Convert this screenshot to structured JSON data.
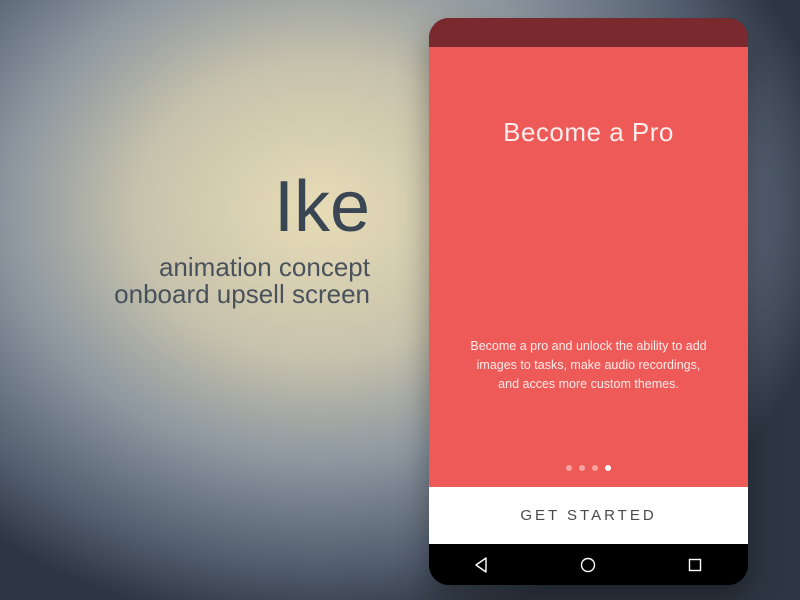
{
  "promo": {
    "title": "Ike",
    "line1": "animation concept",
    "line2": "onboard upsell screen"
  },
  "colors": {
    "accent": "#ee5a57",
    "statusbar": "#7a2a2f",
    "cta_bg": "#ffffff",
    "navbar": "#000000"
  },
  "screen": {
    "headline": "Become a Pro",
    "body": "Become a pro and unlock the ability to add images to tasks, make audio recordings, and acces more custom themes.",
    "pager": {
      "count": 4,
      "active_index": 3
    },
    "cta_label": "GET STARTED"
  },
  "nav": {
    "back": "back-triangle-icon",
    "home": "home-circle-icon",
    "recents": "recents-square-icon"
  }
}
